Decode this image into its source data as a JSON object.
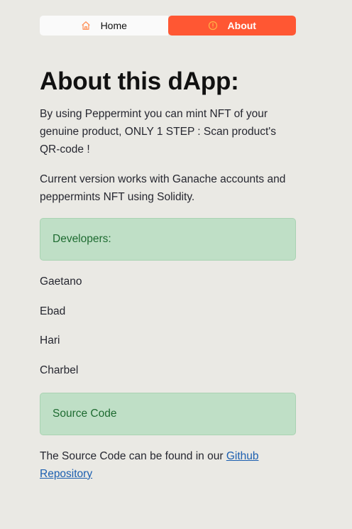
{
  "nav": {
    "home_label": "Home",
    "about_label": "About",
    "home_icon": "house-icon",
    "about_icon": "info-circle-icon",
    "active_color": "#ff5733"
  },
  "page": {
    "title": "About this dApp:",
    "intro": "By using Peppermint you can mint NFT of your genuine product, ONLY 1 STEP : Scan product's QR-code !",
    "version_note": "Current version works with Ganache accounts and peppermints NFT using Solidity."
  },
  "developers": {
    "heading": "Developers:",
    "names": [
      "Gaetano",
      "Ebad",
      "Hari",
      "Charbel"
    ]
  },
  "source": {
    "heading": "Source Code",
    "text_prefix": "The Source Code can be found in our ",
    "link_text": "Github Repository"
  }
}
